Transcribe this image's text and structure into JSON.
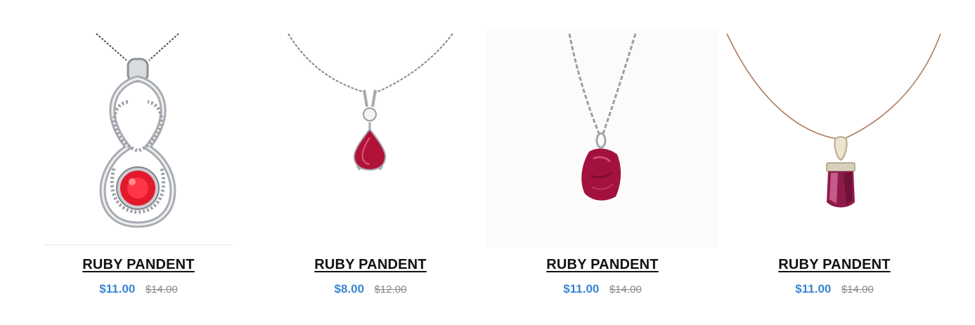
{
  "products": [
    {
      "title": "RUBY PANDENT",
      "price": "$11.00",
      "old_price": "$14.00",
      "image_icon": "ruby-infinity-pendant",
      "stone_color": "#e3192b"
    },
    {
      "title": "RUBY PANDENT",
      "price": "$8.00",
      "old_price": "$12.00",
      "image_icon": "ruby-teardrop-pendant",
      "stone_color": "#b01238"
    },
    {
      "title": "RUBY PANDENT",
      "price": "$11.00",
      "old_price": "$14.00",
      "image_icon": "raw-ruby-pendant",
      "stone_color": "#a3123f"
    },
    {
      "title": "RUBY PANDENT",
      "price": "$11.00",
      "old_price": "$14.00",
      "image_icon": "ruby-crystal-pendant",
      "stone_color": "#8f1a4a"
    }
  ],
  "colors": {
    "price": "#3a86d1",
    "old_price": "#8a8a8a",
    "title": "#111111"
  }
}
